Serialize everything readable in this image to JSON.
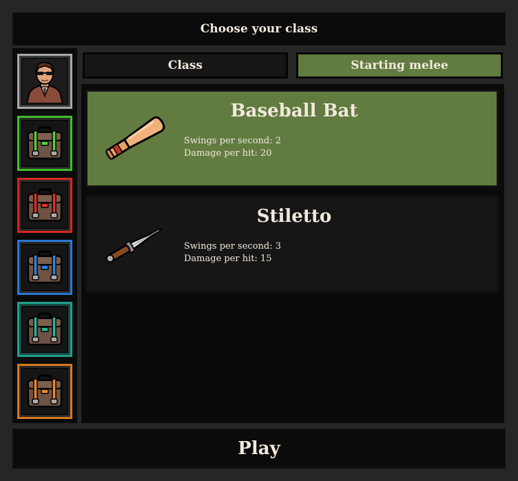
{
  "header": {
    "title": "Choose your class"
  },
  "tabs": [
    {
      "label": "Class",
      "active": false
    },
    {
      "label": "Starting melee",
      "active": true
    }
  ],
  "sidebar": {
    "slots": [
      {
        "name": "character-portrait",
        "border": "#9a9a9a",
        "accent": null
      },
      {
        "name": "class-bag-green",
        "border": "#3fbf2a",
        "accent": "#55d13b"
      },
      {
        "name": "class-bag-red",
        "border": "#d6261f",
        "accent": "#e0302a"
      },
      {
        "name": "class-bag-blue",
        "border": "#2a78d6",
        "accent": "#2f86e6"
      },
      {
        "name": "class-bag-teal",
        "border": "#1fa08a",
        "accent": "#2ab89f"
      },
      {
        "name": "class-bag-orange",
        "border": "#d9781e",
        "accent": "#ee8a2a"
      }
    ]
  },
  "weapons": [
    {
      "name": "Baseball Bat",
      "icon": "baseball-bat-icon",
      "swings": "Swings per second: 2",
      "damage": "Damage per hit: 20",
      "selected": true
    },
    {
      "name": "Stiletto",
      "icon": "stiletto-knife-icon",
      "swings": "Swings per second: 3",
      "damage": "Damage per hit: 15",
      "selected": false
    }
  ],
  "play": {
    "label": "Play"
  },
  "colors": {
    "selected": "#617b41",
    "panel": "#161616",
    "text": "#f2e9dc"
  }
}
